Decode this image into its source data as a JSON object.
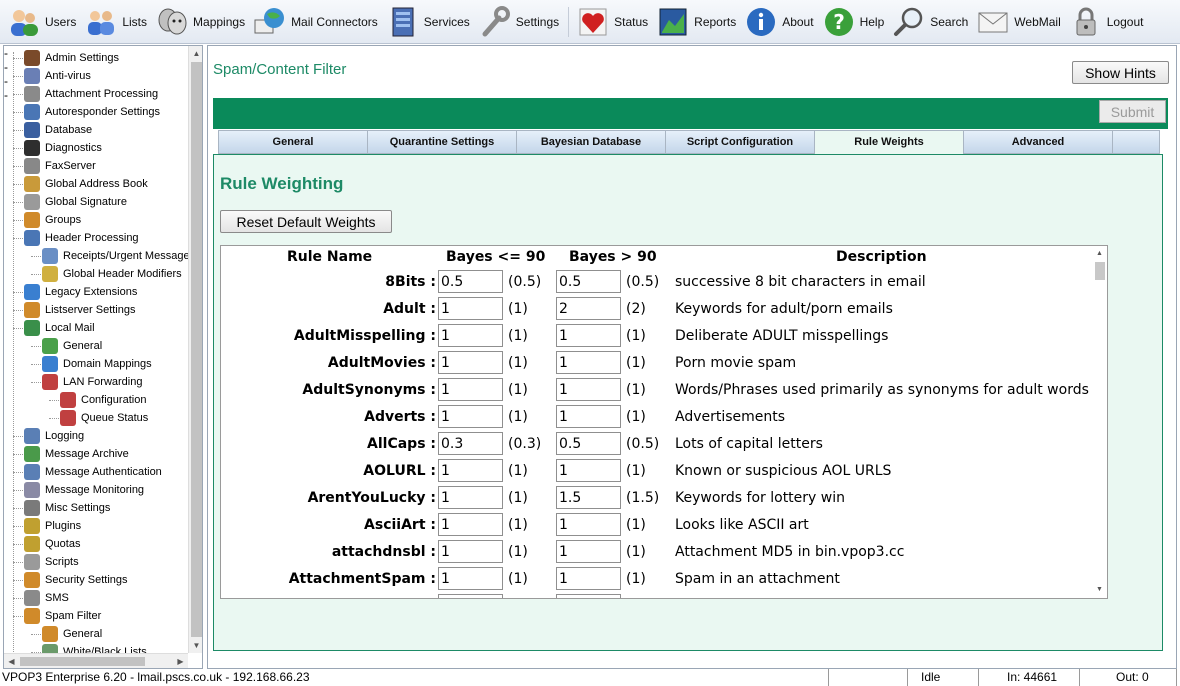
{
  "toolbar": {
    "items": [
      {
        "label": "Users",
        "icon": "users-icon"
      },
      {
        "label": "Lists",
        "icon": "lists-icon"
      },
      {
        "label": "Mappings",
        "icon": "mappings-icon"
      },
      {
        "label": "Mail Connectors",
        "icon": "mail-connectors-icon"
      },
      {
        "label": "Services",
        "icon": "services-icon"
      },
      {
        "label": "Settings",
        "icon": "settings-icon"
      },
      {
        "label": "Status",
        "icon": "status-icon"
      },
      {
        "label": "Reports",
        "icon": "reports-icon"
      },
      {
        "label": "About",
        "icon": "about-icon"
      },
      {
        "label": "Help",
        "icon": "help-icon"
      },
      {
        "label": "Search",
        "icon": "search-icon"
      },
      {
        "label": "WebMail",
        "icon": "webmail-icon"
      },
      {
        "label": "Logout",
        "icon": "logout-icon"
      }
    ]
  },
  "sidebar": {
    "items": [
      {
        "label": "Admin Settings",
        "level": 0,
        "color": "#7a4a2a"
      },
      {
        "label": "Anti-virus",
        "level": 0,
        "color": "#6a7fb5"
      },
      {
        "label": "Attachment Processing",
        "level": 0,
        "color": "#8a8a8a"
      },
      {
        "label": "Autoresponder Settings",
        "level": 0,
        "color": "#4a76b5"
      },
      {
        "label": "Database",
        "level": 0,
        "color": "#3a5fa0"
      },
      {
        "label": "Diagnostics",
        "level": 0,
        "color": "#2e2e2e"
      },
      {
        "label": "FaxServer",
        "level": 0,
        "color": "#888888"
      },
      {
        "label": "Global Address Book",
        "level": 0,
        "color": "#c99a3a"
      },
      {
        "label": "Global Signature",
        "level": 0,
        "color": "#9a9a9a"
      },
      {
        "label": "Groups",
        "level": 0,
        "color": "#d08a2a"
      },
      {
        "label": "Header Processing",
        "level": 0,
        "color": "#4a76b5",
        "toggle": "-"
      },
      {
        "label": "Receipts/Urgent Messages",
        "level": 1,
        "color": "#6a8fc5"
      },
      {
        "label": "Global Header Modifiers",
        "level": 1,
        "color": "#d0b040"
      },
      {
        "label": "Legacy Extensions",
        "level": 0,
        "color": "#3a7fd0"
      },
      {
        "label": "Listserver Settings",
        "level": 0,
        "color": "#d08a2a"
      },
      {
        "label": "Local Mail",
        "level": 0,
        "color": "#3a8f4a",
        "toggle": "-"
      },
      {
        "label": "General",
        "level": 1,
        "color": "#4aa04a"
      },
      {
        "label": "Domain Mappings",
        "level": 1,
        "color": "#3a7fd0"
      },
      {
        "label": "LAN Forwarding",
        "level": 1,
        "color": "#c04040",
        "toggle": "-"
      },
      {
        "label": "Configuration",
        "level": 2,
        "color": "#c04040"
      },
      {
        "label": "Queue Status",
        "level": 2,
        "color": "#c04040"
      },
      {
        "label": "Logging",
        "level": 0,
        "color": "#5a7fb5"
      },
      {
        "label": "Message Archive",
        "level": 0,
        "color": "#4a9a4a"
      },
      {
        "label": "Message Authentication",
        "level": 0,
        "color": "#5a7fb5"
      },
      {
        "label": "Message Monitoring",
        "level": 0,
        "color": "#8a8aa5"
      },
      {
        "label": "Misc Settings",
        "level": 0,
        "color": "#7a7a7a"
      },
      {
        "label": "Plugins",
        "level": 0,
        "color": "#c0a030"
      },
      {
        "label": "Quotas",
        "level": 0,
        "color": "#c0a030"
      },
      {
        "label": "Scripts",
        "level": 0,
        "color": "#9a9a9a"
      },
      {
        "label": "Security Settings",
        "level": 0,
        "color": "#d08a2a"
      },
      {
        "label": "SMS",
        "level": 0,
        "color": "#8a8a8a"
      },
      {
        "label": "Spam Filter",
        "level": 0,
        "color": "#d08a2a",
        "toggle": "-"
      },
      {
        "label": "General",
        "level": 1,
        "color": "#d08a2a"
      },
      {
        "label": "White/Black Lists",
        "level": 1,
        "color": "#6a9a6a"
      }
    ]
  },
  "main": {
    "page_title": "Spam/Content Filter",
    "show_hints_label": "Show Hints",
    "submit_label": "Submit",
    "tabs": [
      {
        "label": "General",
        "active": false
      },
      {
        "label": "Quarantine Settings",
        "active": false
      },
      {
        "label": "Bayesian Database",
        "active": false
      },
      {
        "label": "Script Configuration",
        "active": false
      },
      {
        "label": "Rule Weights",
        "active": true
      },
      {
        "label": "Advanced",
        "active": false
      },
      {
        "label": "",
        "active": false
      }
    ],
    "section_title": "Rule Weighting",
    "reset_label": "Reset Default Weights",
    "table": {
      "headers": {
        "rule_name": "Rule Name",
        "bayes_low": "Bayes <= 90",
        "bayes_high": "Bayes > 90",
        "description": "Description"
      },
      "rows": [
        {
          "name": "8Bits :",
          "low": "0.5",
          "low_default": "(0.5)",
          "high": "0.5",
          "high_default": "(0.5)",
          "description": "successive 8 bit characters in email"
        },
        {
          "name": "Adult :",
          "low": "1",
          "low_default": "(1)",
          "high": "2",
          "high_default": "(2)",
          "description": "Keywords for adult/porn emails"
        },
        {
          "name": "AdultMisspelling :",
          "low": "1",
          "low_default": "(1)",
          "high": "1",
          "high_default": "(1)",
          "description": "Deliberate ADULT misspellings"
        },
        {
          "name": "AdultMovies :",
          "low": "1",
          "low_default": "(1)",
          "high": "1",
          "high_default": "(1)",
          "description": "Porn movie spam"
        },
        {
          "name": "AdultSynonyms :",
          "low": "1",
          "low_default": "(1)",
          "high": "1",
          "high_default": "(1)",
          "description": "Words/Phrases used primarily as synonyms for adult words"
        },
        {
          "name": "Adverts :",
          "low": "1",
          "low_default": "(1)",
          "high": "1",
          "high_default": "(1)",
          "description": "Advertisements"
        },
        {
          "name": "AllCaps :",
          "low": "0.3",
          "low_default": "(0.3)",
          "high": "0.5",
          "high_default": "(0.5)",
          "description": "Lots of capital letters"
        },
        {
          "name": "AOLURL :",
          "low": "1",
          "low_default": "(1)",
          "high": "1",
          "high_default": "(1)",
          "description": "Known or suspicious AOL URLS"
        },
        {
          "name": "ArentYouLucky :",
          "low": "1",
          "low_default": "(1)",
          "high": "1.5",
          "high_default": "(1.5)",
          "description": "Keywords for lottery win"
        },
        {
          "name": "AsciiArt :",
          "low": "1",
          "low_default": "(1)",
          "high": "1",
          "high_default": "(1)",
          "description": "Looks like ASCII art"
        },
        {
          "name": "attachdnsbl :",
          "low": "1",
          "low_default": "(1)",
          "high": "1",
          "high_default": "(1)",
          "description": "Attachment MD5 in bin.vpop3.cc"
        },
        {
          "name": "AttachmentSpam :",
          "low": "1",
          "low_default": "(1)",
          "high": "1",
          "high_default": "(1)",
          "description": "Spam in an attachment"
        }
      ]
    }
  },
  "statusbar": {
    "version": "VPOP3 Enterprise 6.20 - lmail.pscs.co.uk - 192.168.66.23",
    "state": "Idle",
    "in": "In: 44661",
    "out": "Out: 0"
  },
  "colors": {
    "accent": "#1d8a66",
    "green_bar": "#0a8a5a",
    "panel_bg": "#eaf8f2"
  }
}
